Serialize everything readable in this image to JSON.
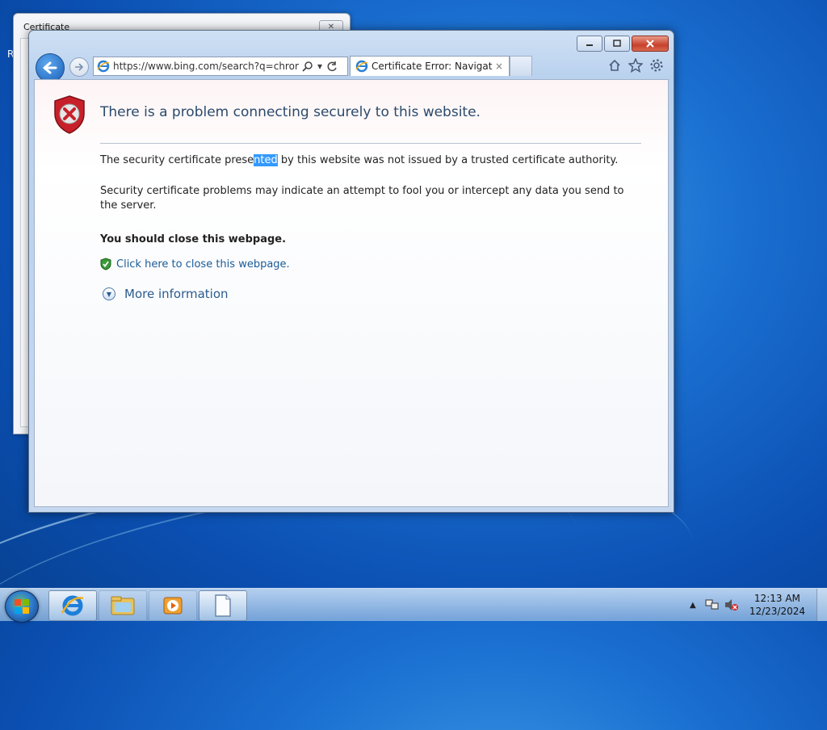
{
  "desktop": {
    "edge_letter": "R"
  },
  "background_window": {
    "title": "Certificate"
  },
  "browser": {
    "address": "https://www.bing.com/search?q=chrome&s",
    "tab_label": "Certificate Error: Navigatio...",
    "tab_close": "×"
  },
  "page": {
    "title": "There is a problem connecting securely to this website.",
    "para1_before": "The security certificate prese",
    "para1_selected": "nted",
    "para1_after": " by this website was not issued by a trusted certificate authority.",
    "para2": "Security certificate problems may indicate an attempt to fool you or intercept any data you send to the server.",
    "close_heading": "You should close this webpage.",
    "close_link": "Click here to close this webpage.",
    "more_info": "More information"
  },
  "taskbar": {
    "clock_time": "12:13 AM",
    "clock_date": "12/23/2024"
  },
  "colors": {
    "title_blue": "#2b4a6b",
    "link_blue": "#1a5b97",
    "selection": "#3399ff",
    "error_red": "#c8202a"
  }
}
